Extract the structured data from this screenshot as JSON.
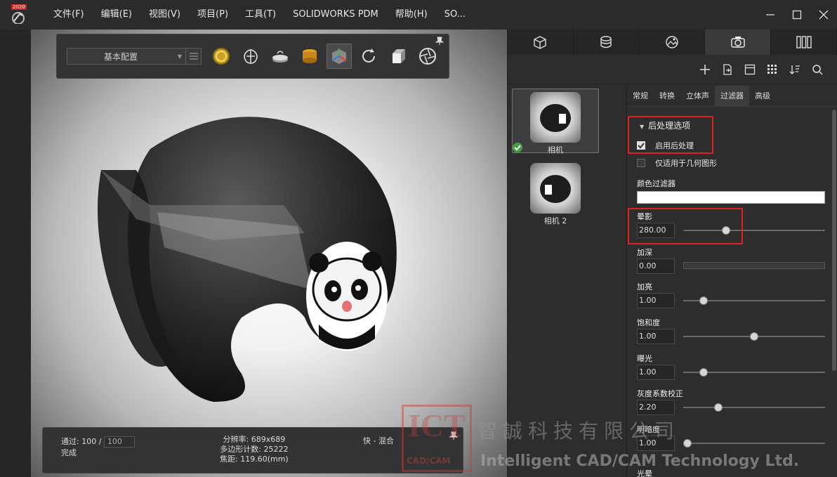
{
  "app": {
    "logo_year": "2020",
    "menu": [
      {
        "label": "文件(F)"
      },
      {
        "label": "编辑(E)"
      },
      {
        "label": "视图(V)"
      },
      {
        "label": "项目(P)"
      },
      {
        "label": "工具(T)"
      },
      {
        "label": "SOLIDWORKS PDM"
      },
      {
        "label": "帮助(H)"
      },
      {
        "label": "SO..."
      }
    ]
  },
  "viewport": {
    "config_value": "基本配置",
    "tool_icons": [
      "ring-icon",
      "brain-icon",
      "turntable-icon",
      "environment-icon",
      "view-axis-icon",
      "refresh-icon",
      "box-icon",
      "aperture-icon"
    ],
    "status": {
      "pass_label": "通过:",
      "pass_value": "100 /",
      "pass_total": "100",
      "state": "完成",
      "resolution": "分辨率: 689x689",
      "polygons": "多边形计数: 25222",
      "focal": "焦距: 119.60(mm)",
      "mode": "快 - 混合"
    }
  },
  "panel": {
    "tabs": [
      "parts-icon",
      "materials-icon",
      "environment-icon",
      "camera-icon",
      "libraries-icon"
    ],
    "active_tab": 3,
    "cameras": [
      {
        "label": "相机",
        "selected": true
      },
      {
        "label": "相机 2",
        "selected": false
      }
    ],
    "prop_tabs": [
      {
        "label": "常规"
      },
      {
        "label": "转换"
      },
      {
        "label": "立体声"
      },
      {
        "label": "过滤器"
      },
      {
        "label": "高级"
      }
    ],
    "active_prop_tab": 3,
    "section_title": "后处理选项",
    "enable_post": "启用后处理",
    "geometry_only": "仅适用于几何图形",
    "color_filter": "颜色过滤器",
    "vignette": {
      "label": "晕影",
      "value": "280.00",
      "fraction": 0.29
    },
    "burn": {
      "label": "加深",
      "value": "0.00"
    },
    "bright": {
      "label": "加亮",
      "value": "1.00",
      "fraction": 0.12
    },
    "saturation": {
      "label": "饱和度",
      "value": "1.00",
      "fraction": 0.5
    },
    "exposure": {
      "label": "曝光",
      "value": "1.00",
      "fraction": 0.12
    },
    "gamma": {
      "label": "灰度系数校正",
      "value": "2.20",
      "fraction": 0.23
    },
    "contrast": {
      "label": "明暗度",
      "value": "1.00",
      "fraction": 0.0
    },
    "next_label": "光晕"
  },
  "watermark": {
    "logo": "ICT",
    "logo_sub": "CAD/CAM",
    "cn": "智誠科技有限公司",
    "en": "Intelligent CAD/CAM Technology Ltd."
  },
  "colors": {
    "highlight": "#e02020",
    "check": "#43a047"
  }
}
